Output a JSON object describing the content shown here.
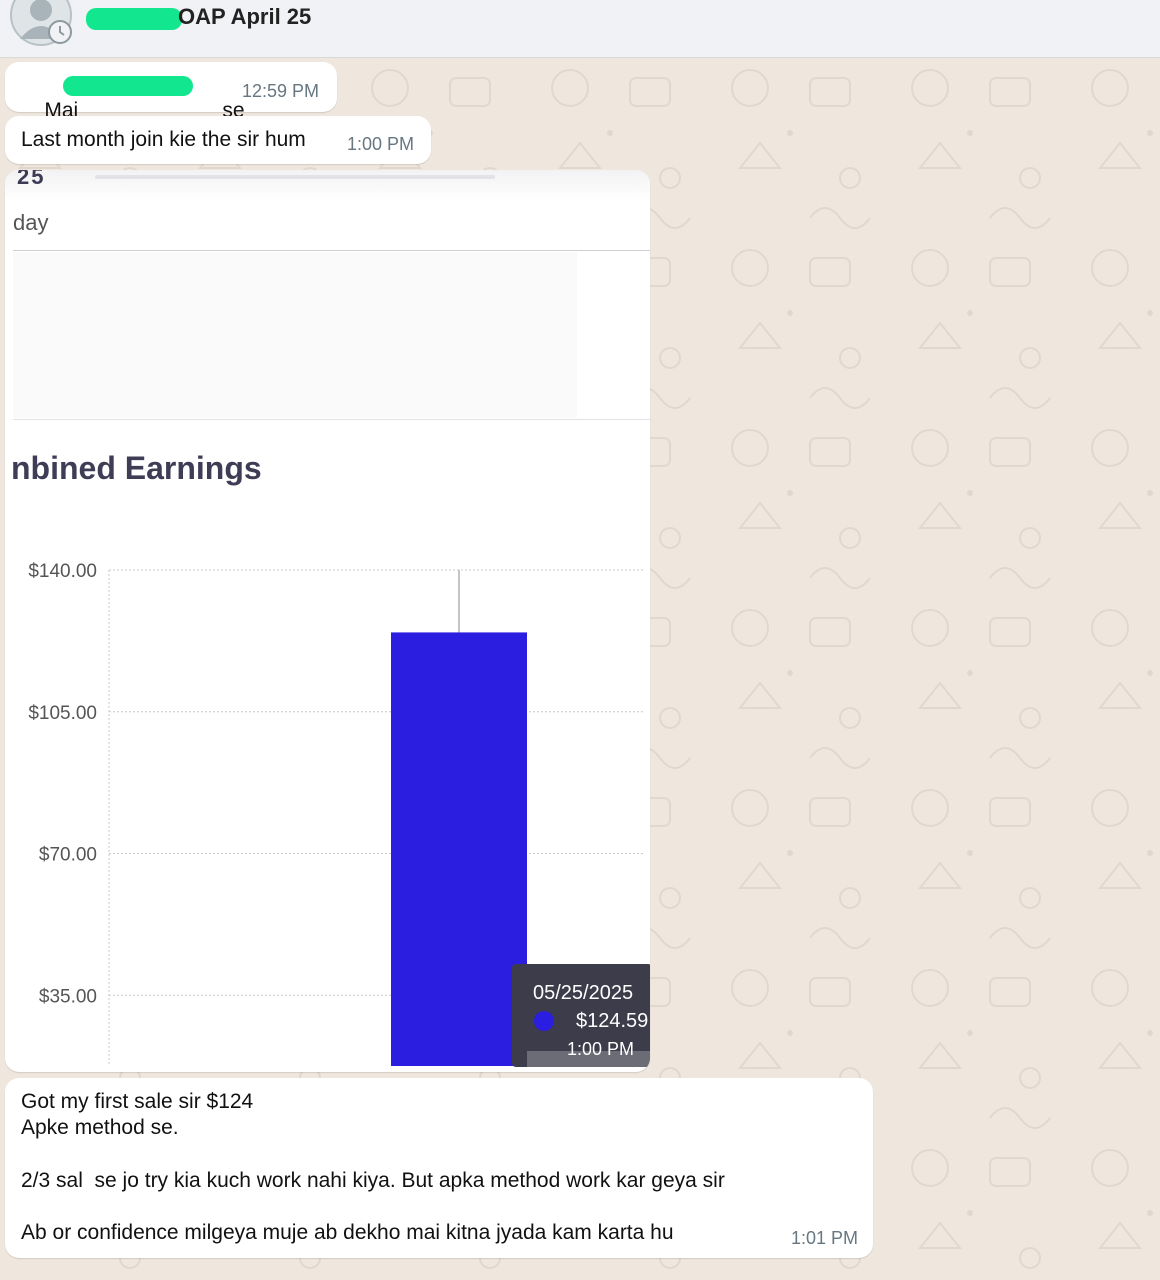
{
  "header": {
    "title_prefix": "",
    "title_suffix": "OAP April 25"
  },
  "messages": [
    {
      "text_start": "Mai",
      "text_end": "se",
      "time": "12:59 PM"
    },
    {
      "text": "Last month join kie the sir hum",
      "time": "1:00 PM"
    },
    {
      "text_lines": [
        "Got my first sale sir $124",
        "Apke method se.",
        "",
        "2/3 sal  se jo try kia kuch work nahi kiya. But apka method work kar geya sir",
        "",
        "Ab or confidence milgeya muje ab dekho mai kitna jyada kam karta hu"
      ],
      "time": "1:01 PM"
    }
  ],
  "screenshot": {
    "top_number": "25",
    "top_label": "day",
    "heading": "nbined Earnings",
    "tooltip": {
      "date": "05/25/2025",
      "value": "$124.59",
      "time": "1:00 PM"
    }
  },
  "chart_data": {
    "type": "bar",
    "title": "Combined Earnings",
    "categories": [
      "05/25/2025"
    ],
    "values": [
      124.59
    ],
    "ylim": [
      20,
      140
    ],
    "yticks": [
      35,
      70,
      105,
      140
    ],
    "ytick_labels": [
      "$35.00",
      "$70.00",
      "$105.00",
      "$140.00"
    ],
    "bar_color": "#2b1ee0",
    "grid": true
  },
  "colors": {
    "bubble": "#ffffff",
    "wallpaper": "#efe7dd",
    "accent_bar": "#2b1ee0",
    "redaction": "#12e68f"
  }
}
